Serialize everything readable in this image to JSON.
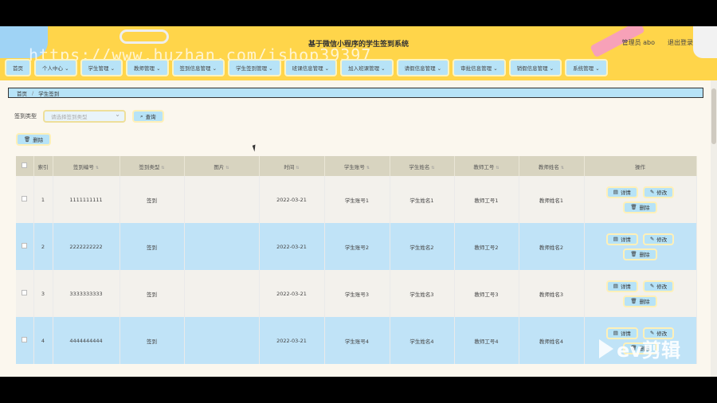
{
  "app": {
    "title": "基于微信小程序的学生签到系统",
    "user_label": "管理员 abo",
    "logout_label": "退出登录",
    "watermark": "https://www.huzhan.com/ishop39397",
    "video_logo": "ev剪辑"
  },
  "nav": [
    {
      "label": "首页"
    },
    {
      "label": "个人中心 ⌄"
    },
    {
      "label": "学生管理 ⌄"
    },
    {
      "label": "教师管理 ⌄"
    },
    {
      "label": "签到信息管理 ⌄"
    },
    {
      "label": "学生签到管理 ⌄"
    },
    {
      "label": "班课信息管理 ⌄"
    },
    {
      "label": "加入班课管理 ⌄"
    },
    {
      "label": "请假信息管理 ⌄"
    },
    {
      "label": "审批信息管理 ⌄"
    },
    {
      "label": "销假信息管理 ⌄"
    },
    {
      "label": "系统管理 ⌄"
    }
  ],
  "breadcrumb": {
    "home": "首页",
    "sep": "/",
    "current": "学生签到"
  },
  "filter": {
    "label": "签到类型",
    "placeholder": "请选择签到类型",
    "query_button": "查询"
  },
  "delete_button": "删除",
  "table": {
    "headers": [
      "索引",
      "签到编号",
      "签到类型",
      "图片",
      "时间",
      "学生账号",
      "学生姓名",
      "教师工号",
      "教师姓名",
      "操作"
    ],
    "rows": [
      {
        "index": "1",
        "code": "1111111111",
        "type": "签到",
        "image": "",
        "time": "2022-03-21",
        "student_id": "学生账号1",
        "student_name": "学生姓名1",
        "teacher_id": "教师工号1",
        "teacher_name": "教师姓名1"
      },
      {
        "index": "2",
        "code": "2222222222",
        "type": "签到",
        "image": "",
        "time": "2022-03-21",
        "student_id": "学生账号2",
        "student_name": "学生姓名2",
        "teacher_id": "教师工号2",
        "teacher_name": "教师姓名2"
      },
      {
        "index": "3",
        "code": "3333333333",
        "type": "签到",
        "image": "",
        "time": "2022-03-21",
        "student_id": "学生账号3",
        "student_name": "学生姓名3",
        "teacher_id": "教师工号3",
        "teacher_name": "教师姓名3"
      },
      {
        "index": "4",
        "code": "4444444444",
        "type": "签到",
        "image": "",
        "time": "2022-03-21",
        "student_id": "学生账号4",
        "student_name": "学生姓名4",
        "teacher_id": "教师工号4",
        "teacher_name": "教师姓名4"
      }
    ],
    "ops": {
      "detail": "详情",
      "edit": "修改",
      "delete": "删除"
    }
  },
  "colors": {
    "header_bg": "#ffd54a",
    "nav_bg": "#b7e3f7",
    "row_alt": "#c0e3f7",
    "page_bg": "#fbf7ee"
  }
}
